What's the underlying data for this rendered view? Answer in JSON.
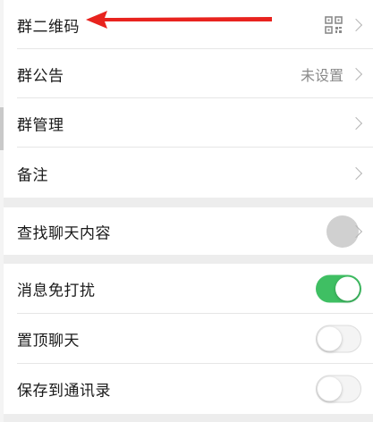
{
  "group_profile": {
    "qr_code_label": "群二维码",
    "announcement_label": "群公告",
    "announcement_value": "未设置",
    "manage_label": "群管理",
    "remark_label": "备注"
  },
  "search": {
    "find_chat_label": "查找聊天内容"
  },
  "settings": {
    "mute_label": "消息免打扰",
    "mute_enabled": true,
    "pin_label": "置顶聊天",
    "pin_enabled": false,
    "save_contacts_label": "保存到通讯录",
    "save_contacts_enabled": false
  },
  "colors": {
    "toggle_on": "#3fbf63",
    "annotation_arrow": "#e8231e"
  },
  "icons": {
    "qr": "qr-code-icon",
    "chevron": "chevron-right-icon",
    "annotation": "red-arrow-annotation"
  }
}
